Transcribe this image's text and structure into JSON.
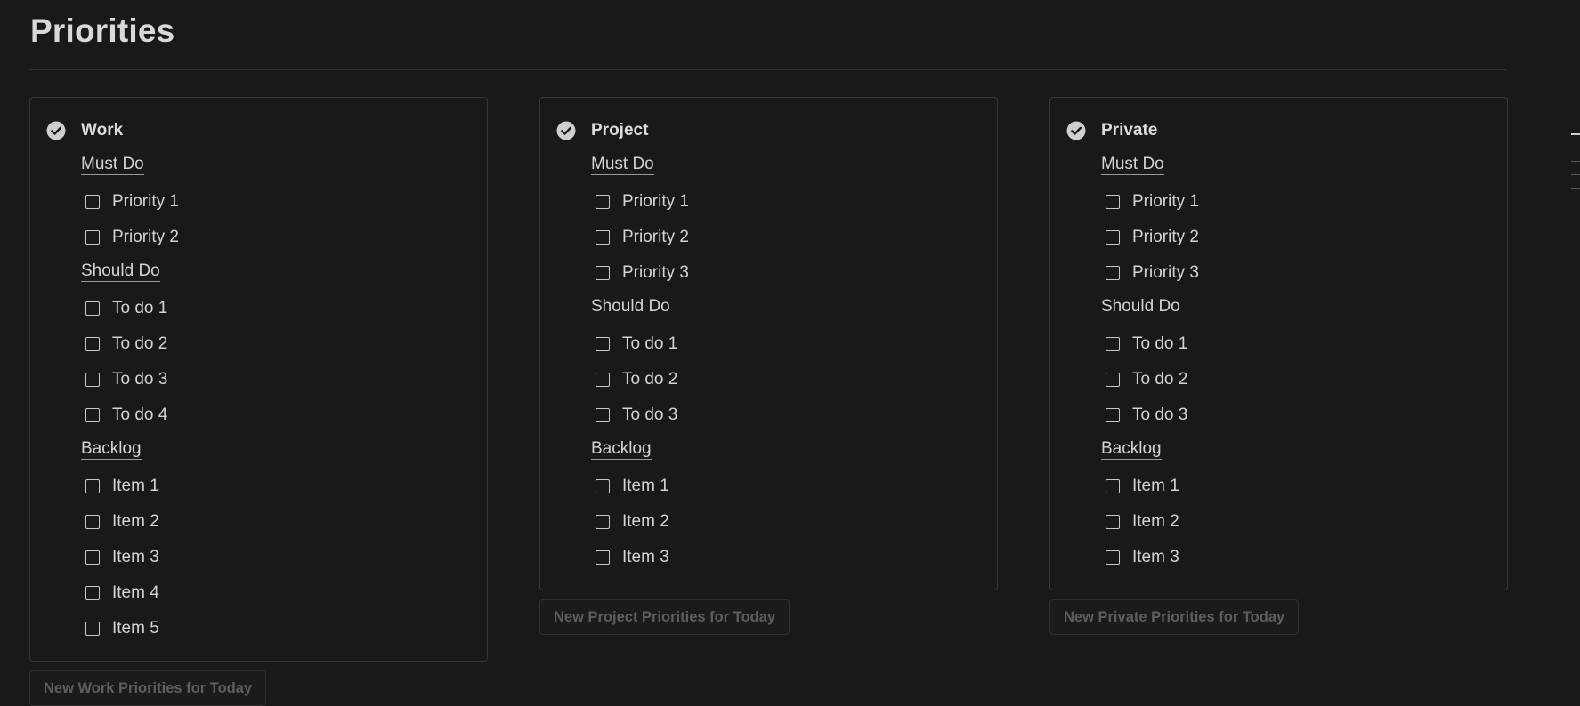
{
  "page": {
    "title": "Priorities"
  },
  "colors": {
    "background": "#191919",
    "card_border": "#363636",
    "text": "#d4d4d4",
    "button_text": "#5e5e5e"
  },
  "icons": {
    "card_header": "check-circle-icon",
    "item": "checkbox-icon"
  },
  "columns": [
    {
      "title": "Work",
      "sections": [
        {
          "heading": "Must Do",
          "items": [
            "Priority 1",
            "Priority 2"
          ]
        },
        {
          "heading": "Should Do",
          "items": [
            "To do 1",
            "To do 2",
            "To do 3",
            "To do 4"
          ]
        },
        {
          "heading": "Backlog",
          "items": [
            "Item 1",
            "Item 2",
            "Item 3",
            "Item 4",
            "Item 5"
          ]
        }
      ],
      "button": "New Work Priorities for Today"
    },
    {
      "title": "Project",
      "sections": [
        {
          "heading": "Must Do",
          "items": [
            "Priority 1",
            "Priority 2",
            "Priority 3"
          ]
        },
        {
          "heading": "Should Do",
          "items": [
            "To do 1",
            "To do 2",
            "To do 3"
          ]
        },
        {
          "heading": "Backlog",
          "items": [
            "Item 1",
            "Item 2",
            "Item 3"
          ]
        }
      ],
      "button": "New Project Priorities for Today"
    },
    {
      "title": "Private",
      "sections": [
        {
          "heading": "Must Do",
          "items": [
            "Priority 1",
            "Priority 2",
            "Priority 3"
          ]
        },
        {
          "heading": "Should Do",
          "items": [
            "To do 1",
            "To do 2",
            "To do 3"
          ]
        },
        {
          "heading": "Backlog",
          "items": [
            "Item 1",
            "Item 2",
            "Item 3"
          ]
        }
      ],
      "button": "New Private Priorities for Today"
    }
  ]
}
